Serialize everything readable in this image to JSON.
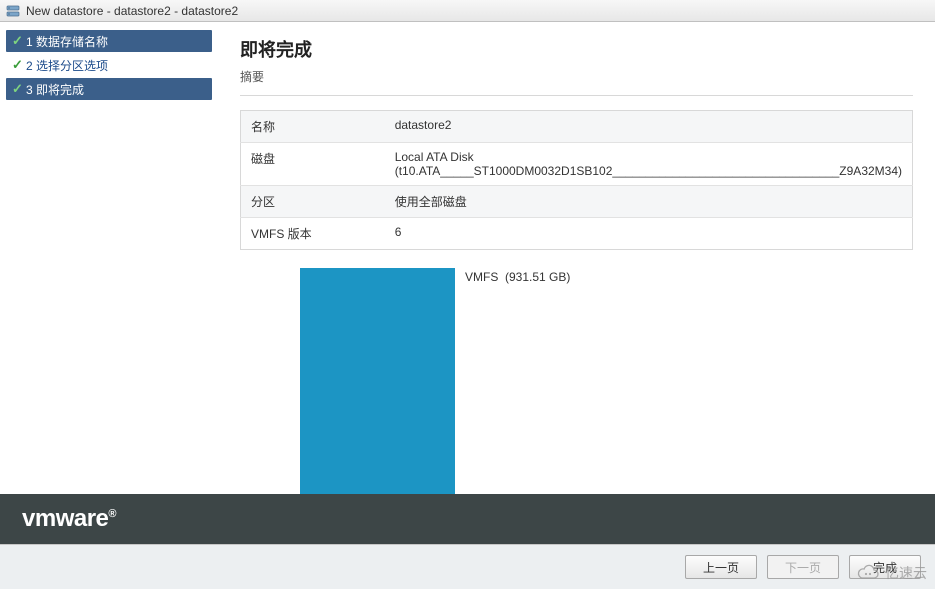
{
  "window": {
    "title": "New datastore - datastore2 - datastore2"
  },
  "wizard": {
    "steps": [
      {
        "num": "1",
        "label": "数据存储名称",
        "completed": true,
        "active": false
      },
      {
        "num": "2",
        "label": "选择分区选项",
        "completed": true,
        "active": false
      },
      {
        "num": "3",
        "label": "即将完成",
        "completed": true,
        "active": true
      }
    ]
  },
  "main": {
    "heading": "即将完成",
    "subtitle": "摘要",
    "rows": [
      {
        "label": "名称",
        "value": "datastore2"
      },
      {
        "label": "磁盘",
        "value": "Local ATA Disk (t10.ATA_____ST1000DM0032D1SB102__________________________________Z9A32M34)"
      },
      {
        "label": "分区",
        "value": "使用全部磁盘"
      },
      {
        "label": "VMFS 版本",
        "value": "6"
      }
    ],
    "disk": {
      "fs": "VMFS",
      "size": "(931.51 GB)"
    }
  },
  "brand": {
    "name": "vmware",
    "reg": "®"
  },
  "buttons": {
    "back": "上一页",
    "next": "下一页",
    "finish": "完成"
  },
  "watermark": {
    "text": "亿速云"
  }
}
